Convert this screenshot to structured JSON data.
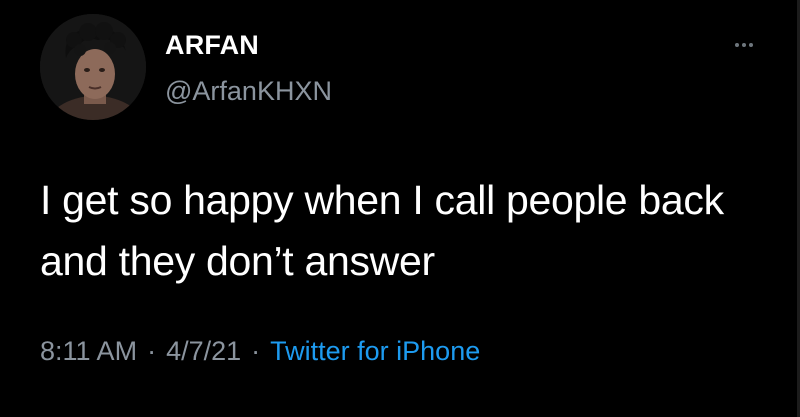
{
  "author": {
    "display_name": "ARFAN",
    "handle": "@ArfanKHXN"
  },
  "tweet": {
    "text_lines": [
      "I get so happy when I call people back",
      "and they don’t answer"
    ],
    "time": "8:11 AM",
    "date": "4/7/21",
    "separator": "·",
    "source": "Twitter for iPhone"
  },
  "icons": {
    "avatar": "profile-photo",
    "more": "more-horizontal-icon"
  },
  "colors": {
    "background": "#000000",
    "text": "#ffffff",
    "secondary_text": "#8b949e",
    "link": "#1d9bf0"
  }
}
